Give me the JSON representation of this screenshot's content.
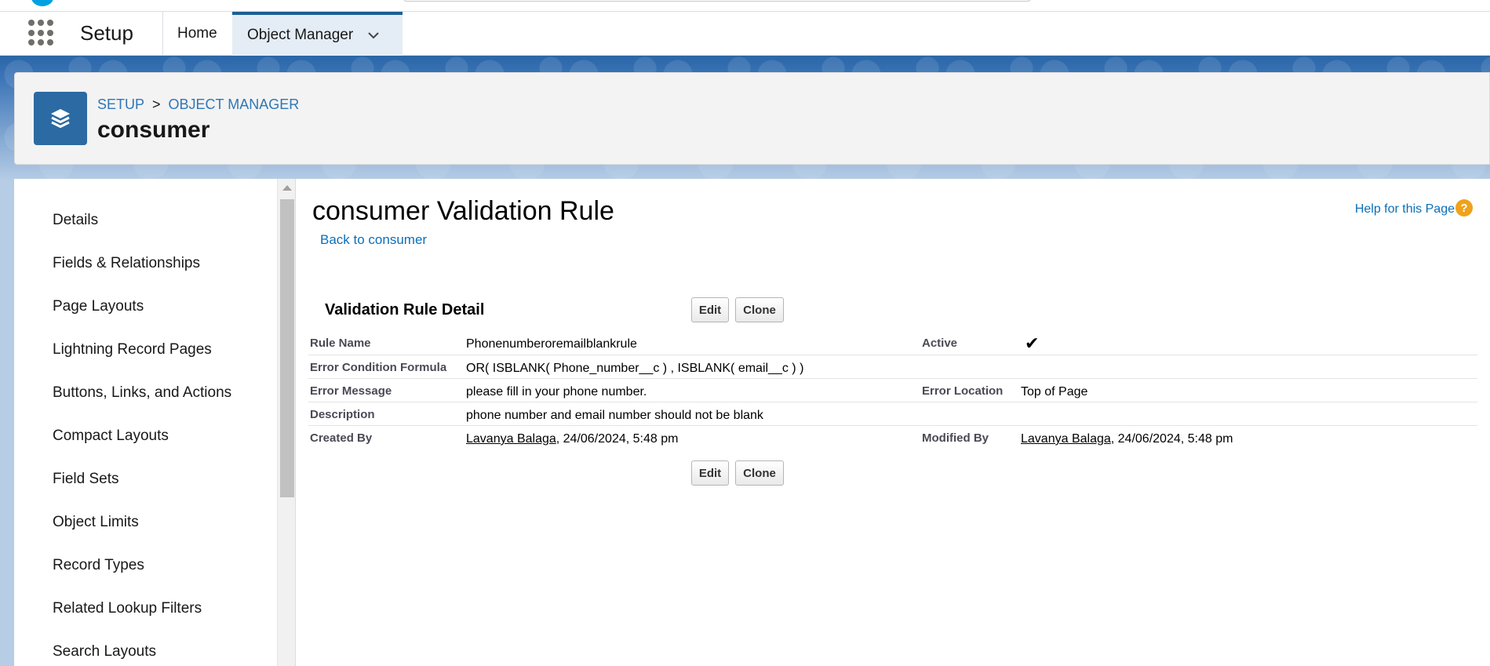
{
  "header": {
    "app_name": "Setup",
    "tabs": [
      {
        "label": "Home"
      },
      {
        "label": "Object Manager"
      }
    ]
  },
  "page_header": {
    "breadcrumb": [
      "SETUP",
      "OBJECT MANAGER"
    ],
    "breadcrumb_separator": ">",
    "title": "consumer"
  },
  "sidebar": {
    "items": [
      {
        "label": "Details"
      },
      {
        "label": "Fields & Relationships"
      },
      {
        "label": "Page Layouts"
      },
      {
        "label": "Lightning Record Pages"
      },
      {
        "label": "Buttons, Links, and Actions"
      },
      {
        "label": "Compact Layouts"
      },
      {
        "label": "Field Sets"
      },
      {
        "label": "Object Limits"
      },
      {
        "label": "Record Types"
      },
      {
        "label": "Related Lookup Filters"
      },
      {
        "label": "Search Layouts"
      }
    ]
  },
  "main": {
    "title": "consumer Validation Rule",
    "back_link": "Back to consumer",
    "help_link": "Help for this Page",
    "help_icon": "?",
    "section_title": "Validation Rule Detail",
    "buttons": {
      "edit": "Edit",
      "clone": "Clone"
    },
    "details": {
      "rule_name_label": "Rule Name",
      "rule_name": "Phonenumberoremailblankrule",
      "active_label": "Active",
      "active_check": "✔",
      "formula_label": "Error Condition Formula",
      "formula": "OR( ISBLANK( Phone_number__c ) , ISBLANK( email__c ) )",
      "error_message_label": "Error Message",
      "error_message": "please fill in your phone number.",
      "error_location_label": "Error Location",
      "error_location": "Top of Page",
      "description_label": "Description",
      "description": "phone number and email number should not be blank",
      "created_by_label": "Created By",
      "created_by_user": "Lavanya Balaga",
      "created_by_date": ", 24/06/2024, 5:48 pm",
      "modified_by_label": "Modified By",
      "modified_by_user": "Lavanya Balaga",
      "modified_by_date": ", 24/06/2024, 5:48 pm"
    }
  },
  "colors": {
    "brand": "#1b5f94",
    "link": "#0b6fb8",
    "icon_bg": "#2b6aa3",
    "help_icon": "#f0a21b"
  }
}
